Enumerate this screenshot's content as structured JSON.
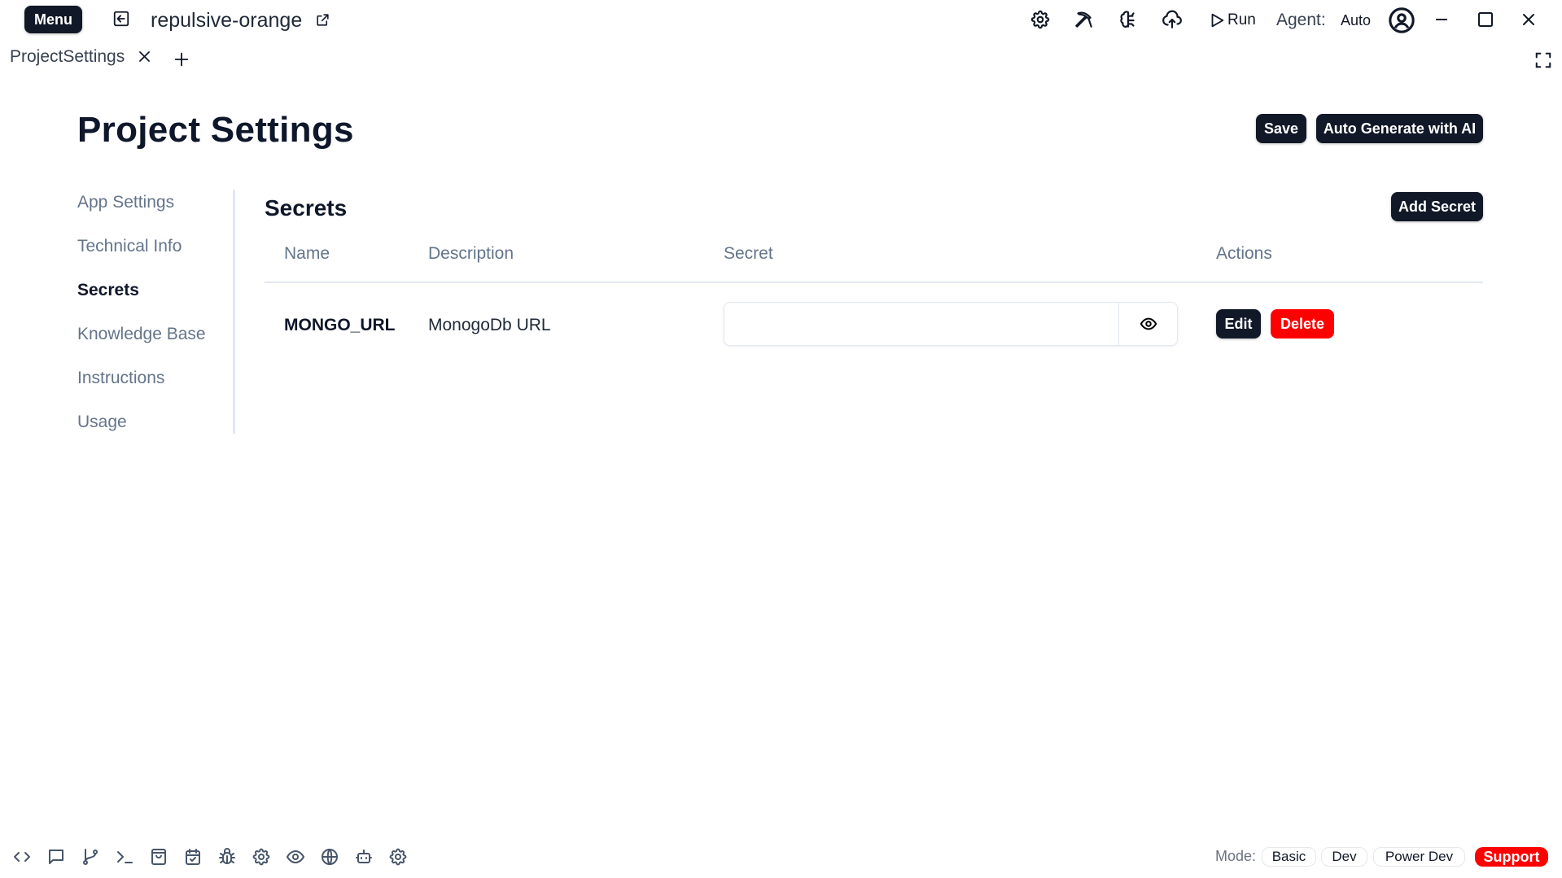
{
  "topbar": {
    "menu_label": "Menu",
    "project_name": "repulsive-orange",
    "icons": [
      "back-icon",
      "external-link-icon",
      "settings-icon",
      "pickaxe-icon",
      "brain-icon",
      "cloud-upload-icon",
      "play-icon"
    ],
    "run_label": "Run",
    "agent_label": "Agent:",
    "agent_value": "Auto"
  },
  "tabs": [
    {
      "label": "ProjectSettings",
      "active": true
    }
  ],
  "header": {
    "title": "Project Settings",
    "save_label": "Save",
    "autogen_label": "Auto Generate with AI"
  },
  "sidebar": {
    "items": [
      {
        "label": "App Settings",
        "active": false
      },
      {
        "label": "Technical Info",
        "active": false
      },
      {
        "label": "Secrets",
        "active": true
      },
      {
        "label": "Knowledge Base",
        "active": false
      },
      {
        "label": "Instructions",
        "active": false
      },
      {
        "label": "Usage",
        "active": false
      }
    ]
  },
  "secrets": {
    "title": "Secrets",
    "add_label": "Add Secret",
    "columns": [
      "Name",
      "Description",
      "Secret",
      "Actions"
    ],
    "rows": [
      {
        "name": "MONGO_URL",
        "description": "MonogoDb URL",
        "secret_value": "",
        "edit_label": "Edit",
        "delete_label": "Delete"
      }
    ]
  },
  "bottombar": {
    "icons": [
      "code-icon",
      "chat-icon",
      "git-branch-icon",
      "terminal-icon",
      "shopping-bag-icon",
      "calendar-check-icon",
      "bug-icon",
      "settings-icon",
      "eye-icon",
      "globe-icon",
      "robot-icon",
      "settings-icon"
    ],
    "mode_label": "Mode:",
    "modes": [
      "Basic",
      "Dev",
      "Power Dev"
    ],
    "support_label": "Support"
  },
  "colors": {
    "primary_dark": "#111827",
    "danger": "#ff0000",
    "muted_text": "#64748b",
    "border": "#e2e8f0"
  }
}
